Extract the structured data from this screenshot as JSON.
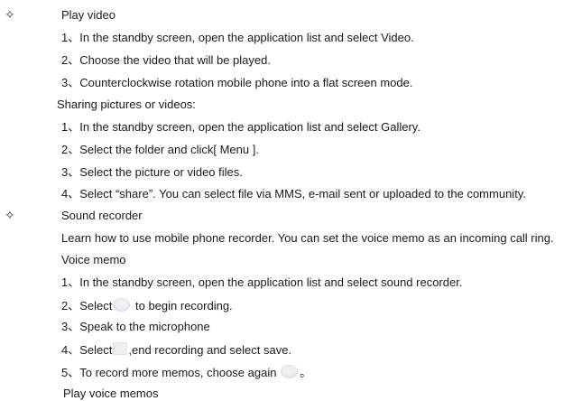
{
  "bullet_glyph": "✧",
  "play_video": {
    "heading": "Play video",
    "steps": [
      "1、In the standby screen, open the application list and select Video.",
      "2、Choose the video that will be played.",
      "3、Counterclockwise rotation mobile phone into a flat screen mode."
    ]
  },
  "sharing": {
    "heading": "Sharing pictures or videos:",
    "steps": [
      "1、In the standby screen, open the application list and select Gallery.",
      "2、Select the folder and click[ Menu ].",
      "3、Select the picture or video files.",
      "4、Select “share”. You can select file via MMS, e-mail sent or uploaded to the community."
    ]
  },
  "sound_recorder": {
    "heading": "Sound recorder",
    "intro": "Learn how to use mobile phone recorder. You can set the voice memo as an incoming call ring.",
    "voice_memo_heading": "Voice memo",
    "step1": "1、In the standby screen, open the application list and select sound recorder.",
    "step2_before": "2、Select",
    "step2_after": " to begin recording.",
    "step3": "3、Speak to the microphone",
    "step4_before": "4、Select",
    "step4_after": ",end recording and select save.",
    "step5_before": "5、To record more memos, choose again ",
    "step5_after": "。",
    "play_voice_memos": "Play voice memos"
  }
}
